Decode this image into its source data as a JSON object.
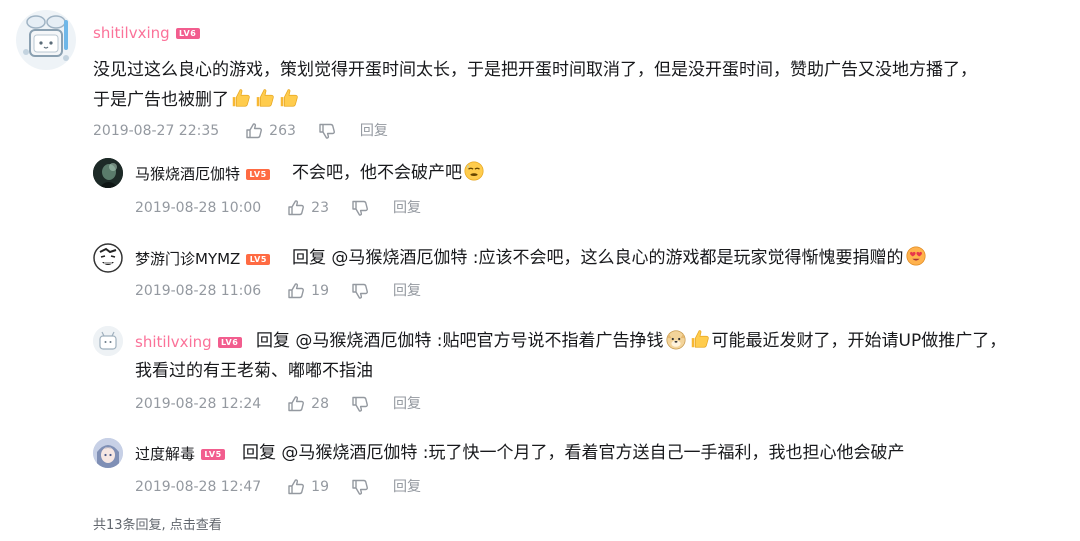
{
  "main_comment": {
    "username": "shitilvxing",
    "level": "LV6",
    "text_line1": "没见过这么良心的游戏，策划觉得开蛋时间太长，于是把开蛋时间取消了，但是没开蛋时间，赞助广告又没地方播了，",
    "text_line2": "于是广告也被删了",
    "time": "2019-08-27 22:35",
    "likes": "263",
    "reply_label": "回复",
    "emojis": [
      "thumbs-up",
      "thumbs-up",
      "thumbs-up"
    ]
  },
  "replies": [
    {
      "username": "马猴烧酒厄伽特",
      "level": "LV5",
      "prefix": "",
      "mention": "",
      "text": "不会吧，他不会破产吧",
      "text2": "",
      "time": "2019-08-28 10:00",
      "likes": "23",
      "reply_label": "回复"
    },
    {
      "username": "梦游门诊MYMZ",
      "level": "LV5",
      "prefix": "回复 ",
      "mention": "@马猴烧酒厄伽特",
      "text": " :应该不会吧，这么良心的游戏都是玩家觉得惭愧要捐赠的",
      "text2": "",
      "time": "2019-08-28 11:06",
      "likes": "19",
      "reply_label": "回复"
    },
    {
      "username": "shitilvxing",
      "level": "LV6",
      "prefix": "回复 ",
      "mention": "@马猴烧酒厄伽特",
      "text": " :贴吧官方号说不指着广告挣钱",
      "text_after": "可能最近发财了，开始请UP做推广了，",
      "text2": "我看过的有王老菊、嘟嘟不指油",
      "time": "2019-08-28 12:24",
      "likes": "28",
      "reply_label": "回复"
    },
    {
      "username": "过度解毒",
      "level": "LV5",
      "prefix": "回复 ",
      "mention": "@马猴烧酒厄伽特",
      "text": " :玩了快一个月了，看着官方送自己一手福利，我也担心他会破产",
      "text2": "",
      "time": "2019-08-28 12:47",
      "likes": "19",
      "reply_label": "回复"
    }
  ],
  "footer": "共13条回复, 点击查看",
  "colors": {
    "username_pink": "#fb7299",
    "meta_gray": "#9499a0",
    "level_badge": "#f25d8e"
  }
}
